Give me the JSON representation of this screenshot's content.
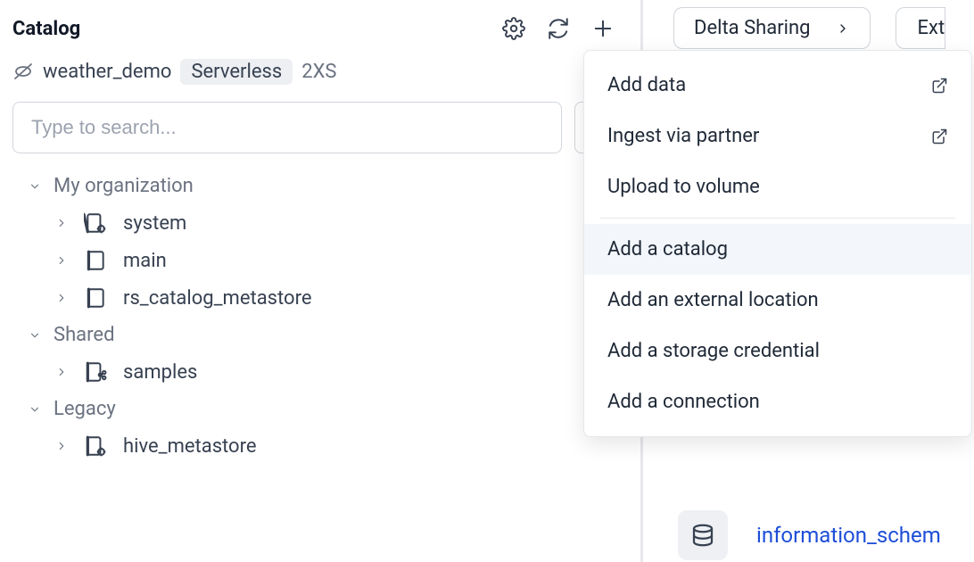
{
  "panel_title": "Catalog",
  "breadcrumb": {
    "name": "weather_demo",
    "badge": "Serverless",
    "size": "2XS"
  },
  "search": {
    "placeholder": "Type to search...",
    "value": ""
  },
  "tree": {
    "groups": [
      {
        "label": "My organization",
        "expanded": true,
        "items": [
          {
            "label": "system",
            "icon": "db-gear"
          },
          {
            "label": "main",
            "icon": "db"
          },
          {
            "label": "rs_catalog_metastore",
            "icon": "db"
          }
        ]
      },
      {
        "label": "Shared",
        "expanded": true,
        "items": [
          {
            "label": "samples",
            "icon": "db-share"
          }
        ]
      },
      {
        "label": "Legacy",
        "expanded": true,
        "items": [
          {
            "label": "hive_metastore",
            "icon": "db-gear"
          }
        ]
      }
    ]
  },
  "right_header": {
    "pills": [
      {
        "label": "Delta Sharing"
      },
      {
        "label": "Ext"
      }
    ]
  },
  "dropdown": {
    "sections": [
      [
        {
          "label": "Add data",
          "external": true
        },
        {
          "label": "Ingest via partner",
          "external": true
        },
        {
          "label": "Upload to volume",
          "external": false
        }
      ],
      [
        {
          "label": "Add a catalog",
          "highlight": true
        },
        {
          "label": "Add an external location"
        },
        {
          "label": "Add a storage credential"
        },
        {
          "label": "Add a connection"
        }
      ]
    ]
  },
  "bottom_peek": {
    "link": "information_schem"
  }
}
